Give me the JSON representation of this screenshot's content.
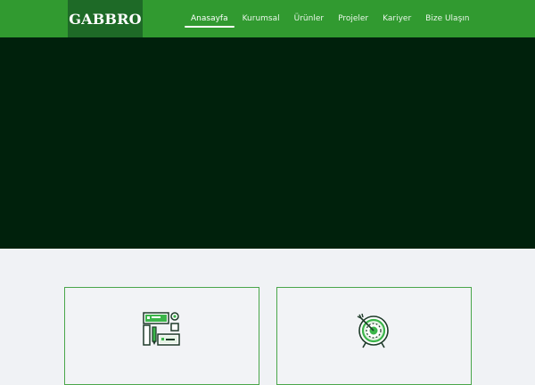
{
  "brand": {
    "logo_text": "GABBRO"
  },
  "nav": {
    "items": [
      {
        "label": "Anasayfa",
        "active": true
      },
      {
        "label": "Kurumsal",
        "active": false
      },
      {
        "label": "Ürünler",
        "active": false
      },
      {
        "label": "Projeler",
        "active": false
      },
      {
        "label": "Kariyer",
        "active": false
      },
      {
        "label": "Bize Ulaşın",
        "active": false
      }
    ]
  },
  "colors": {
    "header_green": "#319a30",
    "logo_green": "#1e6a27",
    "hero_dark": "#00210c",
    "card_border": "#4aa64a",
    "page_bg": "#f0f2f5"
  },
  "cards": [
    {
      "icon": "design-tools-icon"
    },
    {
      "icon": "target-icon"
    }
  ]
}
